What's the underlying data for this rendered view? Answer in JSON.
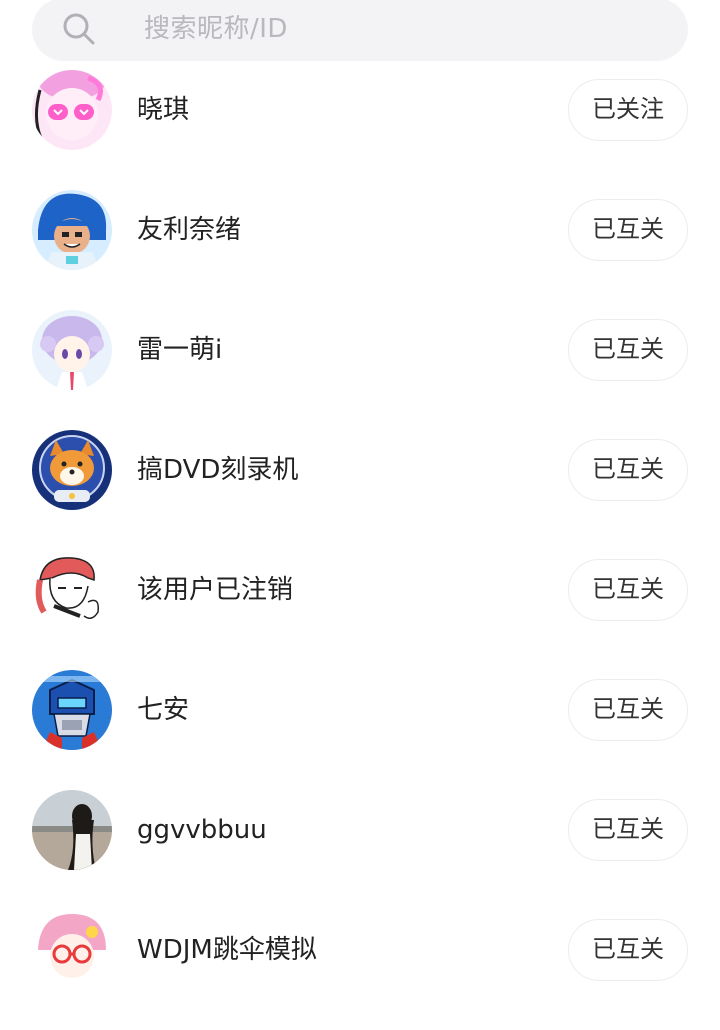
{
  "search": {
    "placeholder": "搜索昵称/ID",
    "icon": "search-icon"
  },
  "users": [
    {
      "name": "晓琪",
      "status": "已关注",
      "avatar": "anime-girl-pink-glasses"
    },
    {
      "name": "友利奈绪",
      "status": "已互关",
      "avatar": "cartoon-boy-blue-hair"
    },
    {
      "name": "雷一萌i",
      "status": "已互关",
      "avatar": "anime-girl-lilac-hair"
    },
    {
      "name": "搞DVD刻录机",
      "status": "已互关",
      "avatar": "shiba-astronaut"
    },
    {
      "name": "该用户已注销",
      "status": "已互关",
      "avatar": "sketch-girl-red-hair"
    },
    {
      "name": "七安",
      "status": "已互关",
      "avatar": "robot-hero"
    },
    {
      "name": "ggvvbbuu",
      "status": "已互关",
      "avatar": "photo-girl-window"
    },
    {
      "name": "WDJM跳伞模拟",
      "status": "已互关",
      "avatar": "anime-pink-hair-glasses"
    }
  ],
  "colors": {
    "background": "#ffffff",
    "search_bg": "#f3f3f5",
    "button_border": "#ececee",
    "placeholder": "#b8b8be"
  }
}
